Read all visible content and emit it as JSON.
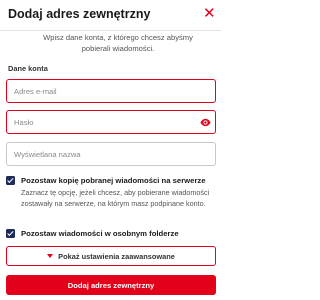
{
  "dialog": {
    "title": "Dodaj adres zewnętrzny",
    "close_symbol": "✕",
    "intro": "Wpisz dane konta, z którego chcesz abyśmy pobierali wiadomości."
  },
  "account_section": {
    "label": "Dane konta",
    "email_placeholder": "Adres e-mail",
    "email_value": "",
    "password_placeholder": "Hasło",
    "password_value": "",
    "display_name_placeholder": "Wyświetlana nazwa",
    "display_name_value": ""
  },
  "options": {
    "keep_copy_label": "Pozostaw kopię pobranej wiadomości na serwerze",
    "keep_copy_checked": true,
    "keep_copy_hint": "Zaznacz tę opcję, jeżeli chcesz, aby pobierane wiadomości zostawały na serwerze, na którym masz podpinane konto.",
    "separate_folder_label": "Pozostaw wiadomości w osobnym folderze",
    "separate_folder_checked": true
  },
  "buttons": {
    "advanced_label": "Pokaż ustawienia zaawansowane",
    "submit_label": "Dodaj adres zewnętrzny"
  },
  "icons": {
    "close": "close-icon",
    "password_visibility": "eye-icon",
    "advanced_toggle": "caret-down-icon"
  },
  "colors": {
    "accent": "#e2001a",
    "checkbox": "#1e2a5a",
    "text": "#1a1a1a",
    "muted": "#555555"
  }
}
